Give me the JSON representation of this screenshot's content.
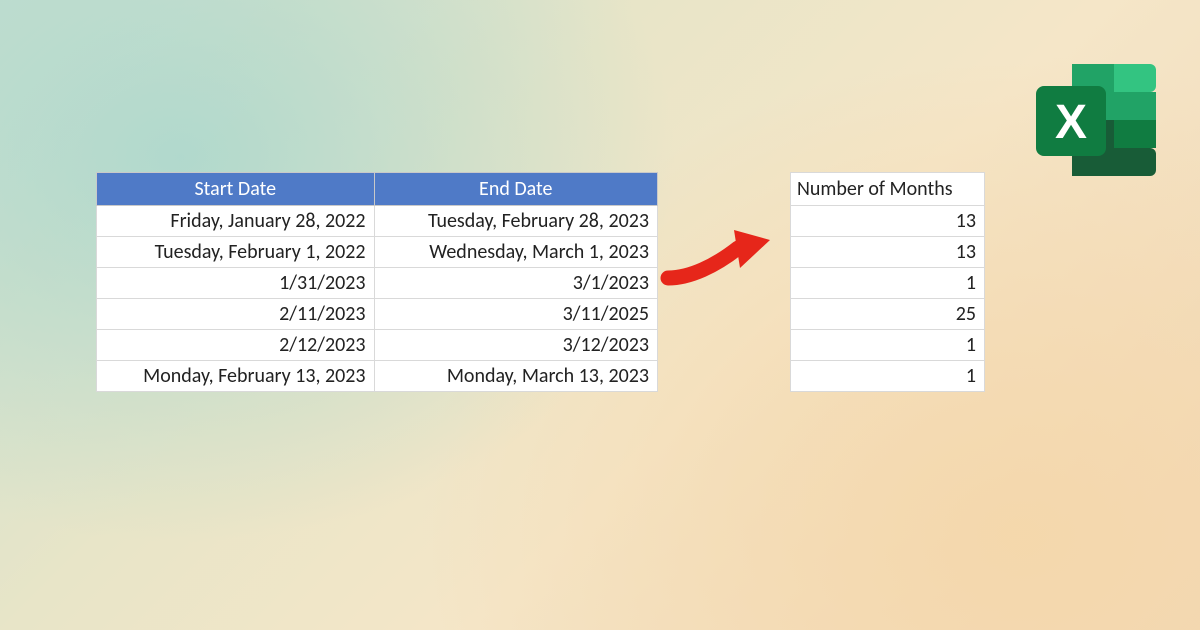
{
  "tables": {
    "dates": {
      "headers": {
        "start": "Start Date",
        "end": "End Date"
      },
      "rows": [
        {
          "start": "Friday, January 28, 2022",
          "end": "Tuesday, February 28, 2023"
        },
        {
          "start": "Tuesday, February 1, 2022",
          "end": "Wednesday, March 1, 2023"
        },
        {
          "start": "1/31/2023",
          "end": "3/1/2023"
        },
        {
          "start": "2/11/2023",
          "end": "3/11/2025"
        },
        {
          "start": "2/12/2023",
          "end": "3/12/2023"
        },
        {
          "start": "Monday, February 13, 2023",
          "end": "Monday, March 13, 2023"
        }
      ]
    },
    "months": {
      "header": "Number of Months",
      "values": [
        "13",
        "13",
        "1",
        "25",
        "1",
        "1"
      ]
    }
  },
  "colors": {
    "table_header_bg": "#4f7ac7",
    "arrow": "#e6261a",
    "excel_dark": "#185c37",
    "excel_mid": "#21a366",
    "excel_light": "#33c481",
    "excel_badge": "#107c41"
  },
  "icons": {
    "arrow": "arrow-right-icon",
    "excel": "excel-icon"
  }
}
